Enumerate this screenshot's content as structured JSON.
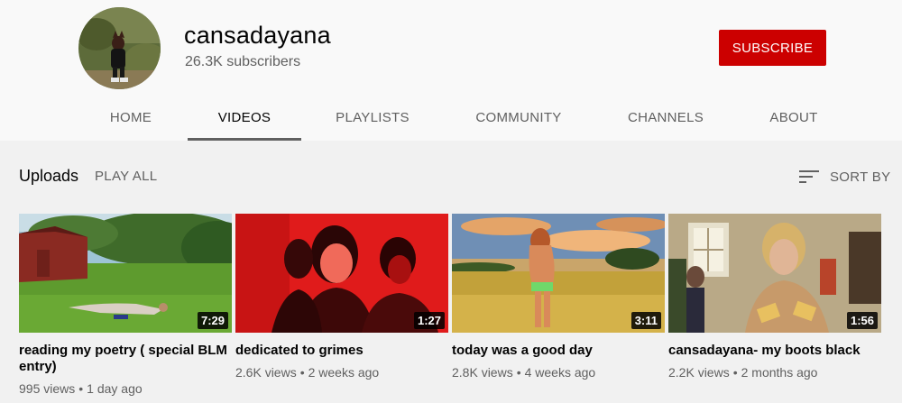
{
  "channel": {
    "name": "cansadayana",
    "subscribers": "26.3K subscribers",
    "subscribe_label": "SUBSCRIBE"
  },
  "tabs": [
    {
      "label": "HOME"
    },
    {
      "label": "VIDEOS",
      "active": true
    },
    {
      "label": "PLAYLISTS"
    },
    {
      "label": "COMMUNITY"
    },
    {
      "label": "CHANNELS"
    },
    {
      "label": "ABOUT"
    }
  ],
  "uploads": {
    "title": "Uploads",
    "play_all": "PLAY ALL",
    "sort_by": "SORT BY"
  },
  "videos": [
    {
      "title": "reading my poetry ( special BLM entry)",
      "duration": "7:29",
      "views": "995 views",
      "age": "1 day ago"
    },
    {
      "title": "dedicated to grimes",
      "duration": "1:27",
      "views": "2.6K views",
      "age": "2 weeks ago"
    },
    {
      "title": "today was a good day",
      "duration": "3:11",
      "views": "2.8K views",
      "age": "4 weeks ago"
    },
    {
      "title": "cansadayana- my boots black",
      "duration": "1:56",
      "views": "2.2K views",
      "age": "2 months ago"
    }
  ],
  "colors": {
    "subscribe": "#cc0000",
    "header_bg": "#f9f9f9",
    "body_bg": "#f1f1f1"
  }
}
